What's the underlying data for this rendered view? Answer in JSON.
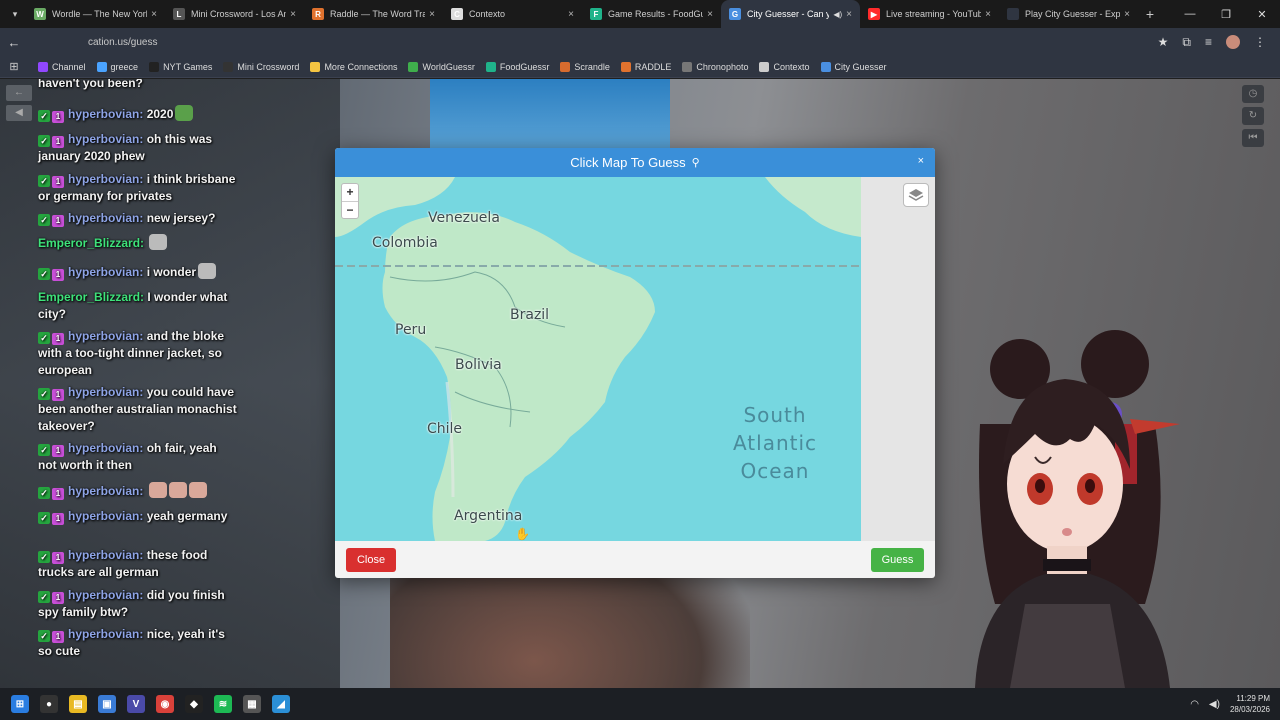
{
  "browser": {
    "tabs": [
      {
        "title": "Wordle — The New York",
        "color": "#6aaa64",
        "glyph": "W",
        "active": false
      },
      {
        "title": "Mini Crossword - Los Ang",
        "color": "#555555",
        "glyph": "L",
        "active": false
      },
      {
        "title": "Raddle — The Word Tran",
        "color": "#e0722e",
        "glyph": "R",
        "active": false
      },
      {
        "title": "Contexto",
        "color": "#dddddd",
        "glyph": "C",
        "active": false
      },
      {
        "title": "Game Results - FoodGue",
        "color": "#1fb38a",
        "glyph": "F",
        "active": false
      },
      {
        "title": "City Guesser - Can yo",
        "color": "#4a8fe0",
        "glyph": "G",
        "active": true
      },
      {
        "title": "Live streaming - YouTube",
        "color": "#ff2b2b",
        "glyph": "▶",
        "active": false
      },
      {
        "title": "Play City Guesser - Explo",
        "color": "#2f3541",
        "glyph": "",
        "active": false
      }
    ],
    "url": "cation.us/guess",
    "bookmarks": [
      {
        "label": "Channel",
        "color": "#9147ff"
      },
      {
        "label": "greece",
        "color": "#4aa3ff"
      },
      {
        "label": "NYT Games",
        "color": "#222222"
      },
      {
        "label": "Mini Crossword",
        "color": "#333333"
      },
      {
        "label": "More Connections",
        "color": "#f5c542"
      },
      {
        "label": "WorldGuessr",
        "color": "#3fae4c"
      },
      {
        "label": "FoodGuessr",
        "color": "#1fb38a"
      },
      {
        "label": "Scrandle",
        "color": "#d66b2e"
      },
      {
        "label": "RADDLE",
        "color": "#e0722e"
      },
      {
        "label": "Chronophoto",
        "color": "#777777"
      },
      {
        "label": "Contexto",
        "color": "#cccccc"
      },
      {
        "label": "City Guesser",
        "color": "#4a8fe0"
      }
    ]
  },
  "chat": [
    {
      "user": "hyperbovian",
      "text": "panda where haven't you been?",
      "badges": true
    },
    {
      "user": "hyperbovian",
      "text": "2020",
      "badges": true
    },
    {
      "user": "hyperbovian",
      "text": "oh this was january 2020 phew",
      "badges": true
    },
    {
      "user": "hyperbovian",
      "text": "i think brisbane or germany for privates",
      "badges": true
    },
    {
      "user": "hyperbovian",
      "text": "new jersey?",
      "badges": true
    },
    {
      "user": "Emperor_Blizzard",
      "text": "",
      "badges": false
    },
    {
      "user": "hyperbovian",
      "text": "i wonder",
      "badges": true
    },
    {
      "user": "Emperor_Blizzard",
      "text": "I wonder what city?",
      "badges": false
    },
    {
      "user": "hyperbovian",
      "text": "and the bloke with a too-tight dinner jacket, so european",
      "badges": true
    },
    {
      "user": "hyperbovian",
      "text": "you could have been another australian monachist takeover?",
      "badges": true
    },
    {
      "user": "hyperbovian",
      "text": "oh fair, yeah not worth it then",
      "badges": true
    },
    {
      "user": "hyperbovian",
      "text": "",
      "badges": true
    },
    {
      "user": "hyperbovian",
      "text": "yeah germany",
      "badges": true
    },
    {
      "user": "hyperbovian",
      "text": "these food trucks are all german",
      "badges": true
    },
    {
      "user": "hyperbovian",
      "text": "did you finish spy family btw?",
      "badges": true
    },
    {
      "user": "hyperbovian",
      "text": "nice, yeah it's so cute",
      "badges": true
    }
  ],
  "modal": {
    "title": "Click Map To Guess",
    "close_x": "×",
    "zoom_in": "+",
    "zoom_out": "−",
    "close_button": "Close",
    "guess_button": "Guess",
    "map_labels": {
      "venezuela": "Venezuela",
      "colombia": "Colombia",
      "peru": "Peru",
      "brazil": "Brazil",
      "bolivia": "Bolivia",
      "chile": "Chile",
      "argentina": "Argentina",
      "ocean_line1": "South",
      "ocean_line2": "Atlantic",
      "ocean_line3": "Ocean"
    }
  },
  "taskbar": {
    "time": "11:29 PM",
    "date": "28/03/2026"
  },
  "colors": {
    "modal_header": "#3a8fd9",
    "close_btn": "#d9302f",
    "guess_btn": "#46b346",
    "ocean": "#76d7e0",
    "land": "#bfe8c8"
  }
}
